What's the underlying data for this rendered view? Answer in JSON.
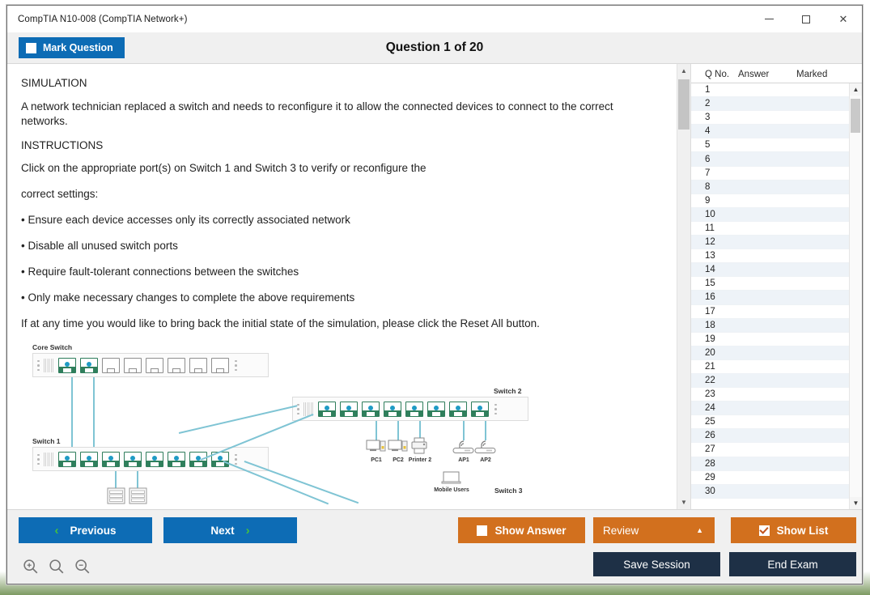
{
  "window": {
    "title": "CompTIA N10-008 (CompTIA Network+)",
    "minimize_label": "minimize",
    "maximize_label": "maximize",
    "close_label": "✕"
  },
  "header": {
    "mark_question_label": "Mark Question",
    "mark_question_checked": false,
    "question_title": "Question 1 of 20"
  },
  "content": {
    "heading_simulation": "SIMULATION",
    "scenario": "A network technician replaced a switch and needs to reconfigure it to allow the connected devices to connect to the correct networks.",
    "heading_instructions": "INSTRUCTIONS",
    "instruction_line_1": "Click on the appropriate port(s) on Switch 1 and Switch 3 to verify or reconfigure the",
    "instruction_line_2": "correct settings:",
    "bullets": [
      "• Ensure each device accesses only its correctly associated network",
      "• Disable all unused switch ports",
      "• Require fault-tolerant connections between the switches",
      "• Only make necessary changes to complete the above requirements"
    ],
    "reset_note": "If at any time you would like to bring back the initial state of the simulation, please click the Reset All button."
  },
  "diagram": {
    "core_switch_label": "Core Switch",
    "switch1_label": "Switch 1",
    "switch2_label": "Switch 2",
    "switch3_label": "Switch 3",
    "devices": [
      {
        "name": "PC1",
        "icon": "desktop-icon"
      },
      {
        "name": "PC2",
        "icon": "desktop-icon"
      },
      {
        "name": "Printer 2",
        "icon": "printer-icon"
      },
      {
        "name": "AP1",
        "icon": "access-point-icon"
      },
      {
        "name": "AP2",
        "icon": "access-point-icon"
      },
      {
        "name": "Mobile Users",
        "icon": "laptop-icon"
      }
    ],
    "core_switch_ports": [
      true,
      true,
      false,
      false,
      false,
      false,
      false,
      false
    ],
    "switch1_ports": [
      true,
      true,
      true,
      true,
      true,
      true,
      true,
      true
    ],
    "switch2_ports": [
      true,
      true,
      true,
      true,
      true,
      true,
      true,
      true
    ]
  },
  "question_list": {
    "columns": [
      "Q No.",
      "Answer",
      "Marked"
    ],
    "rows": [
      {
        "no": "1",
        "answer": "",
        "marked": ""
      },
      {
        "no": "2",
        "answer": "",
        "marked": ""
      },
      {
        "no": "3",
        "answer": "",
        "marked": ""
      },
      {
        "no": "4",
        "answer": "",
        "marked": ""
      },
      {
        "no": "5",
        "answer": "",
        "marked": ""
      },
      {
        "no": "6",
        "answer": "",
        "marked": ""
      },
      {
        "no": "7",
        "answer": "",
        "marked": ""
      },
      {
        "no": "8",
        "answer": "",
        "marked": ""
      },
      {
        "no": "9",
        "answer": "",
        "marked": ""
      },
      {
        "no": "10",
        "answer": "",
        "marked": ""
      },
      {
        "no": "11",
        "answer": "",
        "marked": ""
      },
      {
        "no": "12",
        "answer": "",
        "marked": ""
      },
      {
        "no": "13",
        "answer": "",
        "marked": ""
      },
      {
        "no": "14",
        "answer": "",
        "marked": ""
      },
      {
        "no": "15",
        "answer": "",
        "marked": ""
      },
      {
        "no": "16",
        "answer": "",
        "marked": ""
      },
      {
        "no": "17",
        "answer": "",
        "marked": ""
      },
      {
        "no": "18",
        "answer": "",
        "marked": ""
      },
      {
        "no": "19",
        "answer": "",
        "marked": ""
      },
      {
        "no": "20",
        "answer": "",
        "marked": ""
      },
      {
        "no": "21",
        "answer": "",
        "marked": ""
      },
      {
        "no": "22",
        "answer": "",
        "marked": ""
      },
      {
        "no": "23",
        "answer": "",
        "marked": ""
      },
      {
        "no": "24",
        "answer": "",
        "marked": ""
      },
      {
        "no": "25",
        "answer": "",
        "marked": ""
      },
      {
        "no": "26",
        "answer": "",
        "marked": ""
      },
      {
        "no": "27",
        "answer": "",
        "marked": ""
      },
      {
        "no": "28",
        "answer": "",
        "marked": ""
      },
      {
        "no": "29",
        "answer": "",
        "marked": ""
      },
      {
        "no": "30",
        "answer": "",
        "marked": ""
      }
    ]
  },
  "footer": {
    "previous_label": "Previous",
    "previous_chevron": "‹",
    "next_label": "Next",
    "next_chevron": "›",
    "show_answer_label": "Show Answer",
    "show_answer_checked": false,
    "review_label": "Review",
    "review_caret": "▲",
    "show_list_label": "Show List",
    "show_list_checked": true,
    "save_session_label": "Save Session",
    "end_exam_label": "End Exam",
    "zoom_in_icon": "zoom-in-icon",
    "zoom_reset_icon": "zoom-icon",
    "zoom_out_icon": "zoom-out-icon"
  },
  "colors": {
    "primary_blue": "#0d6cb5",
    "accent_orange": "#d2701e",
    "navy": "#1e3046",
    "chevron_green": "#45c23c",
    "port_green": "#2f7f5c",
    "port_dot_blue": "#1f9bc4",
    "cable": "#7fc4d4"
  }
}
